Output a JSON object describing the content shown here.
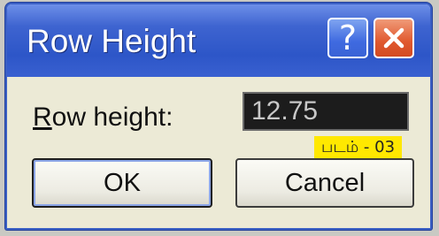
{
  "window": {
    "title": "Row Height",
    "help_icon": "?",
    "close_icon": "close-x-icon",
    "colors": {
      "titlebar": "#2d56c8",
      "close_button": "#e0592f",
      "help_button": "#3f6ae0",
      "body": "#ecead6"
    }
  },
  "form": {
    "label_underlined": "R",
    "label_rest": "ow height:",
    "value": "12.75"
  },
  "badge": {
    "text": "படம் - 03",
    "color": "#ffe800"
  },
  "buttons": {
    "ok_label": "OK",
    "cancel_label": "Cancel"
  }
}
